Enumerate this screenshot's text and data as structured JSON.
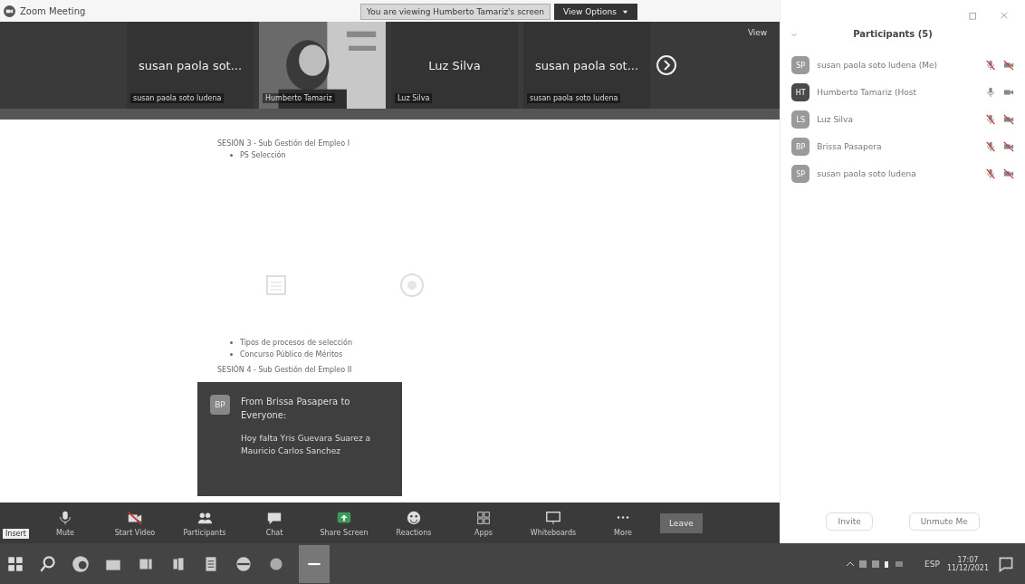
{
  "window": {
    "title": "Zoom Meeting"
  },
  "banner": {
    "text": "You are viewing Humberto Tamariz's screen",
    "button": "View Options"
  },
  "video_strip": {
    "view_label": "View",
    "tiles": [
      {
        "kind": "name",
        "big_name": "susan paola sot...",
        "label": "susan paola soto ludena"
      },
      {
        "kind": "video",
        "label": "Humberto Tamariz"
      },
      {
        "kind": "name",
        "big_name": "Luz Silva",
        "label": "Luz Silva"
      },
      {
        "kind": "name",
        "big_name": "susan paola sot...",
        "label": "susan paola soto ludena"
      }
    ]
  },
  "document": {
    "blocks": [
      {
        "kind": "heading",
        "text": "SESIÓN 3 - Sub Gestión del Empleo I"
      },
      {
        "kind": "bullet",
        "text": "PS Selección"
      },
      {
        "kind": "logos"
      },
      {
        "kind": "bullet",
        "text": "Tipos de procesos de selección"
      },
      {
        "kind": "bullet",
        "text": "Concurso Público de Méritos"
      },
      {
        "kind": "heading",
        "text": "SESIÓN 4 - Sub Gestión del Empleo II"
      }
    ]
  },
  "chat_popup": {
    "initials": "BP",
    "from": "From Brissa Pasapera to Everyone:",
    "message": "Hoy falta Yris Guevara Suarez a Mauricio Carlos Sanchez"
  },
  "toolbar": {
    "tooltip": "Insert",
    "buttons": [
      {
        "kind": "mic",
        "label": "Mute"
      },
      {
        "kind": "video",
        "label": "Start Video"
      },
      {
        "kind": "people",
        "label": "Participants"
      },
      {
        "kind": "chat",
        "label": "Chat"
      },
      {
        "kind": "share",
        "label": "Share Screen"
      },
      {
        "kind": "smile",
        "label": "Reactions"
      },
      {
        "kind": "apps",
        "label": "Apps"
      },
      {
        "kind": "board",
        "label": "Whiteboards"
      },
      {
        "kind": "more",
        "label": "More"
      }
    ],
    "leave": "Leave"
  },
  "participants": {
    "title": "Participants (5)",
    "items": [
      {
        "initials": "SP",
        "name": "susan paola soto ludena (Me)",
        "color": "#9a9a9a",
        "mic_muted": true,
        "video_off": true
      },
      {
        "initials": "HT",
        "name": "Humberto Tamariz (Host",
        "color": "#4a4a4a",
        "mic_muted": false,
        "video_off": false
      },
      {
        "initials": "LS",
        "name": "Luz Silva",
        "color": "#9a9a9a",
        "mic_muted": true,
        "video_off": true
      },
      {
        "initials": "BP",
        "name": "Brissa Pasapera",
        "color": "#9a9a9a",
        "mic_muted": true,
        "video_off": true
      },
      {
        "initials": "SP",
        "name": "susan paola soto ludena",
        "color": "#9a9a9a",
        "mic_muted": true,
        "video_off": true
      }
    ],
    "buttons": [
      "Invite",
      "Unmute Me"
    ]
  },
  "taskbar": {
    "language": "ESP",
    "time": "17:07",
    "date": "11/12/2021"
  }
}
